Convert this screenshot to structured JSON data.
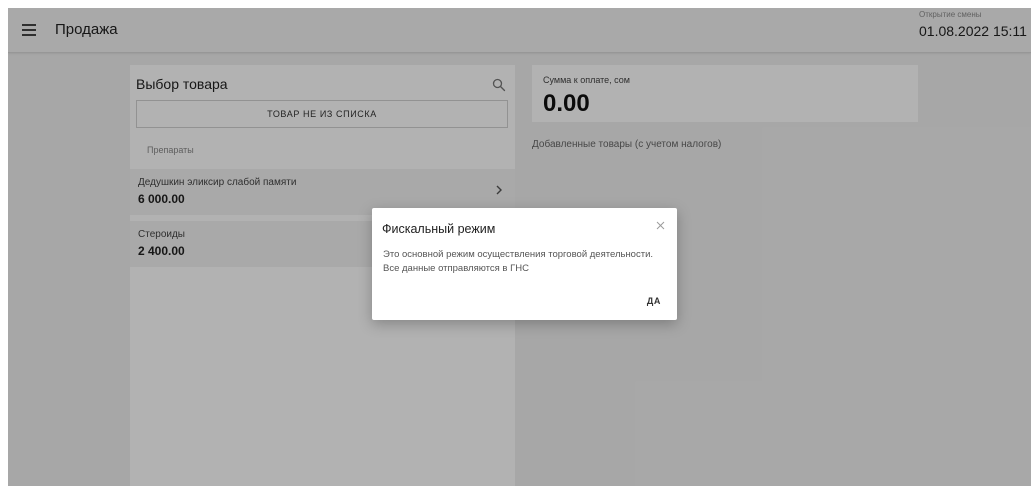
{
  "header": {
    "title": "Продажа",
    "menu_icon": "hamburger-menu-icon",
    "shift_label": "Открытие смены",
    "shift_value": "01.08.2022 15:11"
  },
  "product_panel": {
    "title": "Выбор товара",
    "search_icon": "search-icon",
    "custom_item_button": "ТОВАР НЕ ИЗ СПИСКА",
    "category_label": "Препараты",
    "items": [
      {
        "name": "Дедушкин эликсир слабой памяти",
        "price": "6 000.00"
      },
      {
        "name": "Стероиды",
        "price": "2 400.00"
      }
    ]
  },
  "summary": {
    "sum_label": "Сумма к оплате, сом",
    "sum_value": "0.00",
    "added_label": "Добавленные товары (с учетом налогов)"
  },
  "modal": {
    "title": "Фискальный режим",
    "body": "Это основной режим осуществления торговой деятельности. Все данные отправляются в ГНС",
    "ok_label": "ДА",
    "close_icon": "close-icon"
  },
  "colors": {
    "background": "#f0f0f0",
    "card": "#ffffff",
    "row": "#f2f2f2",
    "overlay": "rgba(0,0,0,0.30)"
  }
}
